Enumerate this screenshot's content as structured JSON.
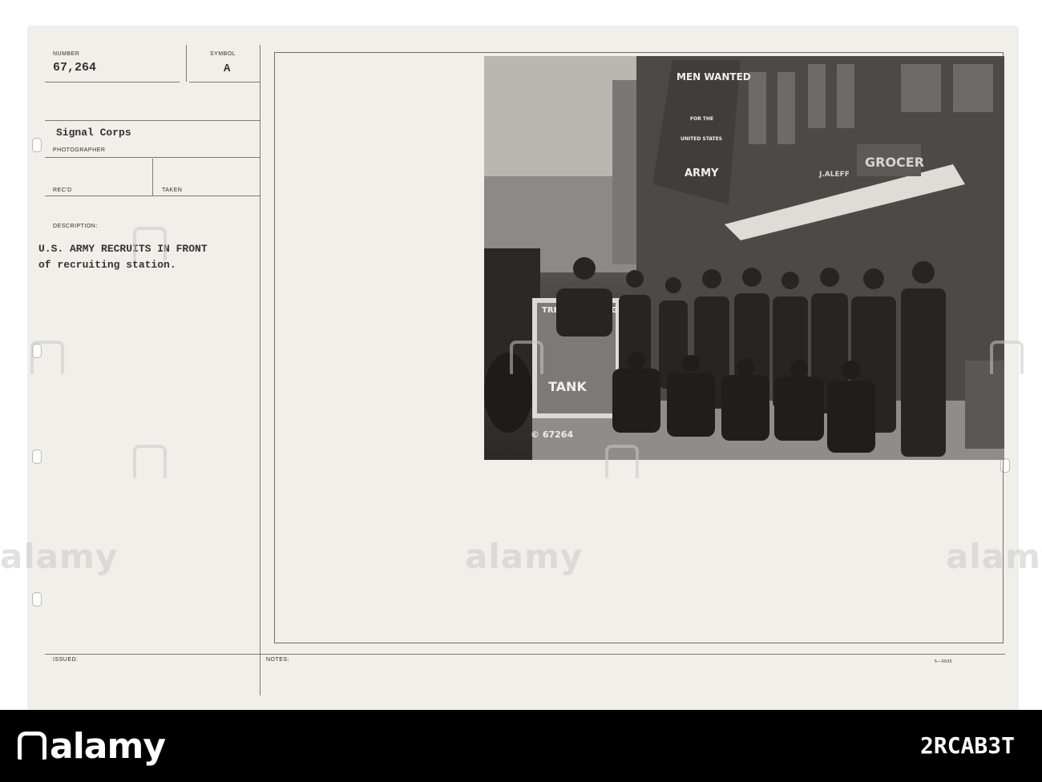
{
  "record": {
    "number_label": "NUMBER",
    "number_value": "67,264",
    "symbol_label": "SYMBOL",
    "symbol_value": "A",
    "photographer_value": "Signal Corps",
    "photographer_label": "PHOTOGRAPHER",
    "recd_label": "REC'D",
    "taken_label": "TAKEN",
    "description_label": "DESCRIPTION:",
    "description_line1": "U.S. ARMY RECRUITS IN FRONT",
    "description_line2": "of recruiting station.",
    "issued_label": "ISSUED:",
    "notes_label": "NOTES:",
    "form_code": "5—6605"
  },
  "photo": {
    "banner_line1": "MEN WANTED",
    "banner_line2": "FOR THE",
    "banner_line3": "UNITED STATES",
    "banner_line4": "ARMY",
    "poster_title": "TREAT 'EM ROUGH",
    "poster_word": "TANK",
    "store_sign": "GROCER",
    "store_name": "J.ALEFF",
    "photo_number": "© 67264"
  },
  "watermark": {
    "text": "alamy"
  },
  "footer": {
    "logo": "alamy",
    "image_id": "2RCAB3T"
  },
  "colors": {
    "card_background": "#f1efea",
    "footer_background": "#000000",
    "rule_color": "#7d7b76"
  }
}
